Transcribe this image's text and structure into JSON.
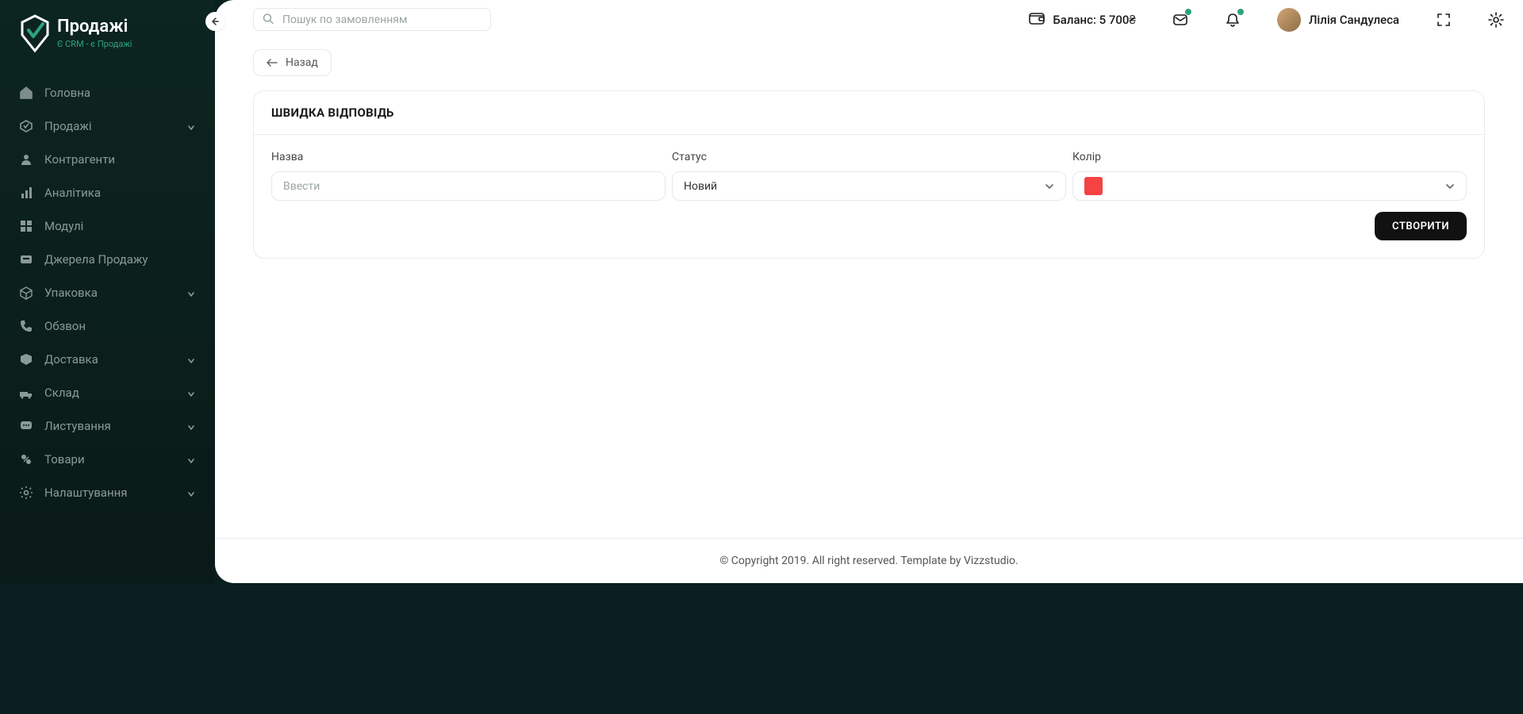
{
  "brand": {
    "name": "Продажі",
    "tagline": "Є CRM - є Продажі"
  },
  "sidebar": {
    "items": [
      {
        "label": "Головна",
        "icon": "home-icon",
        "expandable": false
      },
      {
        "label": "Продажі",
        "icon": "sales-icon",
        "expandable": true
      },
      {
        "label": "Контрагенти",
        "icon": "user-icon",
        "expandable": false
      },
      {
        "label": "Аналітика",
        "icon": "chart-icon",
        "expandable": false
      },
      {
        "label": "Модулі",
        "icon": "modules-icon",
        "expandable": false
      },
      {
        "label": "Джерела Продажу",
        "icon": "sources-icon",
        "expandable": false
      },
      {
        "label": "Упаковка",
        "icon": "package-icon",
        "expandable": true
      },
      {
        "label": "Обзвон",
        "icon": "phone-icon",
        "expandable": false
      },
      {
        "label": "Доставка",
        "icon": "delivery-icon",
        "expandable": true
      },
      {
        "label": "Склад",
        "icon": "warehouse-icon",
        "expandable": true
      },
      {
        "label": "Листування",
        "icon": "messages-icon",
        "expandable": true
      },
      {
        "label": "Товари",
        "icon": "goods-icon",
        "expandable": true
      },
      {
        "label": "Налаштування",
        "icon": "settings-icon",
        "expandable": true
      }
    ]
  },
  "search": {
    "placeholder": "Пошук по замовленням"
  },
  "topbar": {
    "balance_label": "Баланс: 5 700₴",
    "user_name": "Лілія Сандулеса"
  },
  "back_label": "Назад",
  "card": {
    "title": "ШВИДКА ВІДПОВІДЬ",
    "fields": {
      "name": {
        "label": "Назва",
        "placeholder": "Ввести",
        "value": ""
      },
      "status": {
        "label": "Статус",
        "value": "Новий"
      },
      "color": {
        "label": "Колір",
        "value": "#f54242"
      }
    },
    "submit_label": "СТВОРИТИ"
  },
  "footer": {
    "text": "© Copyright 2019. All right reserved. Template by Vizzstudio."
  }
}
